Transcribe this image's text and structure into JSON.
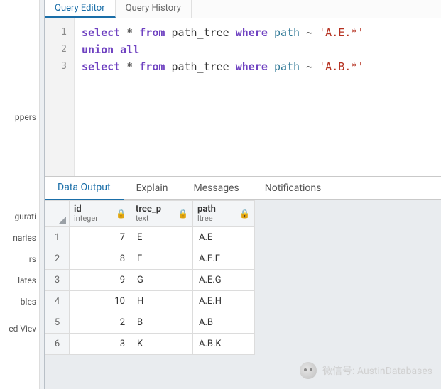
{
  "sidebar": {
    "items": [
      "ppers",
      "gurati",
      "naries",
      "rs",
      "lates",
      "bles",
      "ed Viev"
    ]
  },
  "top_tabs": {
    "editor": "Query Editor",
    "history": "Query History"
  },
  "editor": {
    "lines": [
      "1",
      "2",
      "3"
    ],
    "tokens": {
      "select": "select",
      "star": "*",
      "from": "from",
      "table": "path_tree",
      "where": "where",
      "col": "path",
      "tilde": "~",
      "lit1": "'A.E.*'",
      "union": "union all",
      "lit2": "'A.B.*'"
    }
  },
  "result_tabs": {
    "data": "Data Output",
    "explain": "Explain",
    "messages": "Messages",
    "notifications": "Notifications"
  },
  "columns": [
    {
      "name": "id",
      "type": "integer"
    },
    {
      "name": "tree_p",
      "type": "text"
    },
    {
      "name": "path",
      "type": "ltree"
    }
  ],
  "rows": [
    {
      "n": "1",
      "id": "7",
      "tree_p": "E",
      "path": "A.E"
    },
    {
      "n": "2",
      "id": "8",
      "tree_p": "F",
      "path": "A.E.F"
    },
    {
      "n": "3",
      "id": "9",
      "tree_p": "G",
      "path": "A.E.G"
    },
    {
      "n": "4",
      "id": "10",
      "tree_p": "H",
      "path": "A.E.H"
    },
    {
      "n": "5",
      "id": "2",
      "tree_p": "B",
      "path": "A.B"
    },
    {
      "n": "6",
      "id": "3",
      "tree_p": "K",
      "path": "A.B.K"
    }
  ],
  "watermark": {
    "label": "微信号",
    "sep": ":",
    "value": "AustinDatabases"
  }
}
